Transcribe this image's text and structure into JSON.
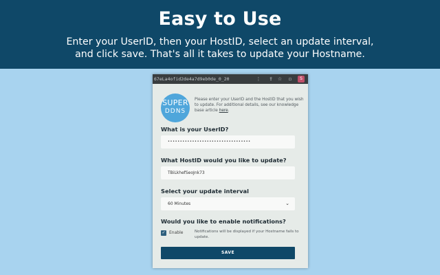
{
  "banner": {
    "title": "Easy to Use",
    "subtitle_line1": "Enter your UserID, then your HostID, select an update interval,",
    "subtitle_line2": "and click save. That's all it takes to update your Hostname."
  },
  "browser": {
    "url": "67eLa4ofid2de4a7d9eb0de_0_20"
  },
  "logo": {
    "line1": "SUPER",
    "line2": "DDNS"
  },
  "intro": {
    "text": "Please enter your UserID and the HostID that you wish to update. For additional details, see our knowledge base article ",
    "link": "here",
    "end": "."
  },
  "userid": {
    "label": "What is your UserID?",
    "value": "••••••••••••••••••••••••••••••••••"
  },
  "hostid": {
    "label": "What HostID would you like to update?",
    "value": "TBiLkhefSeoJnk73"
  },
  "interval": {
    "label": "Select your update interval",
    "selected": "60 Minutes"
  },
  "notifications": {
    "label": "Would you like to enable notifications?",
    "checkbox_label": "Enable",
    "checked": true,
    "note": "Notifications will be displayed if your Hostname fails to update."
  },
  "save_label": "SAVE",
  "colors": {
    "banner": "#0f4868",
    "background": "#a8d3ef",
    "accent": "#0f4868",
    "logo": "#4fa6db"
  }
}
